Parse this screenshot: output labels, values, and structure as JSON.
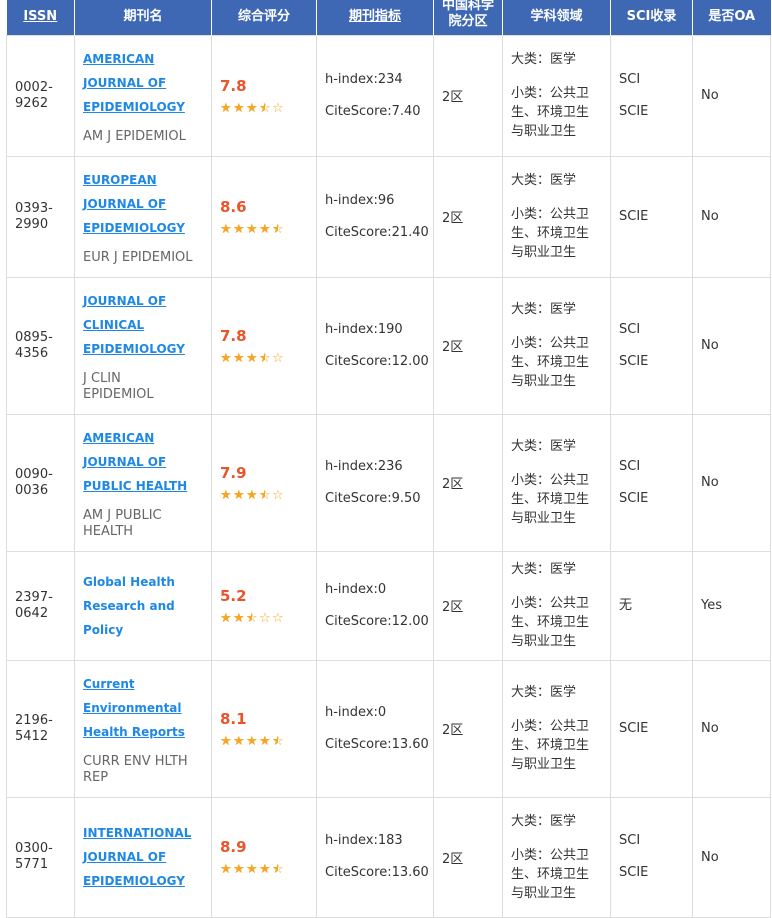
{
  "headers": {
    "issn": "ISSN",
    "journal": "期刊名",
    "score": "综合评分",
    "metrics": "期刊指标",
    "zone": "中国科学院分区",
    "field": "学科领域",
    "sci": "SCI收录",
    "oa": "是否OA"
  },
  "colors": {
    "header_bg": "#3f68b4",
    "link": "#1e88e5",
    "score": "#e8552a",
    "star": "#f5a623"
  },
  "rows": [
    {
      "issn_a": "0002-",
      "issn_b": "9262",
      "title": [
        "AMERICAN",
        "JOURNAL OF",
        "EPIDEMIOLOGY"
      ],
      "abbr": [
        "AM J EPIDEMIOL"
      ],
      "score": "7.8",
      "rating": 3.5,
      "hindex": "h-index:234",
      "citescore": "CiteScore:7.40",
      "zone": "2区",
      "major": "大类：医学",
      "minor": [
        "小类：公共卫",
        "生、环境卫生",
        "与职业卫生"
      ],
      "sci": [
        "SCI",
        "SCIE"
      ],
      "oa": "No"
    },
    {
      "issn_a": "0393-",
      "issn_b": "2990",
      "title": [
        "EUROPEAN",
        "JOURNAL OF",
        "EPIDEMIOLOGY"
      ],
      "abbr": [
        "EUR J EPIDEMIOL"
      ],
      "score": "8.6",
      "rating": 4.5,
      "hindex": "h-index:96",
      "citescore": "CiteScore:21.40",
      "zone": "2区",
      "major": "大类：医学",
      "minor": [
        "小类：公共卫",
        "生、环境卫生",
        "与职业卫生"
      ],
      "sci": [
        "SCIE"
      ],
      "oa": "No"
    },
    {
      "issn_a": "0895-",
      "issn_b": "4356",
      "title": [
        "JOURNAL OF",
        "CLINICAL",
        "EPIDEMIOLOGY"
      ],
      "abbr": [
        "J CLIN",
        "EPIDEMIOL"
      ],
      "score": "7.8",
      "rating": 3.5,
      "hindex": "h-index:190",
      "citescore": "CiteScore:12.00",
      "zone": "2区",
      "major": "大类：医学",
      "minor": [
        "小类：公共卫",
        "生、环境卫生",
        "与职业卫生"
      ],
      "sci": [
        "SCI",
        "SCIE"
      ],
      "oa": "No"
    },
    {
      "issn_a": "0090-",
      "issn_b": "0036",
      "title": [
        "AMERICAN",
        "JOURNAL OF",
        "PUBLIC HEALTH"
      ],
      "abbr": [
        "AM J PUBLIC",
        "HEALTH"
      ],
      "score": "7.9",
      "rating": 3.5,
      "hindex": "h-index:236",
      "citescore": "CiteScore:9.50",
      "zone": "2区",
      "major": "大类：医学",
      "minor": [
        "小类：公共卫",
        "生、环境卫生",
        "与职业卫生"
      ],
      "sci": [
        "SCI",
        "SCIE"
      ],
      "oa": "No"
    },
    {
      "issn_a": "2397-",
      "issn_b": "0642",
      "title": [
        "Global Health",
        "Research and Policy"
      ],
      "title_plain": true,
      "abbr": [],
      "score": "5.2",
      "rating": 2.5,
      "hindex": "h-index:0",
      "citescore": "CiteScore:12.00",
      "zone": "2区",
      "major": "大类：医学",
      "minor": [
        "小类：公共卫",
        "生、环境卫生",
        "与职业卫生"
      ],
      "sci": [
        "无"
      ],
      "oa": "Yes"
    },
    {
      "issn_a": "2196-",
      "issn_b": "5412",
      "title": [
        "Current",
        "Environmental",
        "Health Reports"
      ],
      "abbr": [
        "CURR ENV HLTH",
        "REP"
      ],
      "score": "8.1",
      "rating": 4.5,
      "hindex": "h-index:0",
      "citescore": "CiteScore:13.60",
      "zone": "2区",
      "major": "大类：医学",
      "minor": [
        "小类：公共卫",
        "生、环境卫生",
        "与职业卫生"
      ],
      "sci": [
        "SCIE"
      ],
      "oa": "No"
    },
    {
      "issn_a": "0300-",
      "issn_b": "5771",
      "title": [
        "INTERNATIONAL",
        "JOURNAL OF",
        "EPIDEMIOLOGY"
      ],
      "abbr": [],
      "score": "8.9",
      "rating": 4.5,
      "hindex": "h-index:183",
      "citescore": "CiteScore:13.60",
      "zone": "2区",
      "major": "大类：医学",
      "minor": [
        "小类：公共卫",
        "生、环境卫生",
        "与职业卫生"
      ],
      "sci": [
        "SCI",
        "SCIE"
      ],
      "oa": "No"
    }
  ]
}
